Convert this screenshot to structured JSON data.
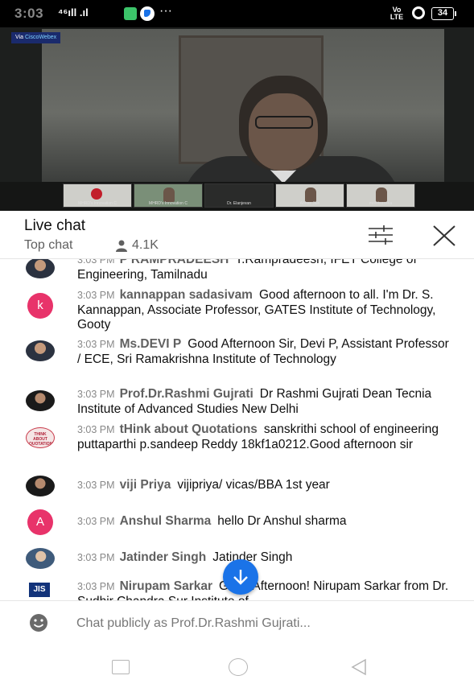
{
  "status_bar": {
    "time": "3:03",
    "signal": "⁴⁶ıll .ıl",
    "dots": "···",
    "volte": "Vo LTE",
    "battery": "34"
  },
  "video": {
    "badge_prefix": "Via ",
    "badge_brand": "CiscoWebex",
    "thumbnails": [
      "MHRD's Innovation C",
      "MHRD's Innovation C",
      "Dr. Elanjevan",
      "Abhas Jain",
      "mohitsaxena"
    ]
  },
  "chat": {
    "title": "Live chat",
    "mode": "Top chat",
    "viewers": "4.1K",
    "messages": [
      {
        "time": "3:03 PM",
        "author": "P RAMPRADEESH",
        "text": "T.Rampradeesh, IFET College of Engineering, Tamilnadu",
        "avatar": "photo"
      },
      {
        "time": "3:03 PM",
        "author": "kannappan sadasivam",
        "text": "Good afternoon to all. I'm Dr. S. Kannappan, Associate Professor, GATES Institute of Technology, Gooty",
        "avatar": "k"
      },
      {
        "time": "3:03 PM",
        "author": "Ms.DEVI P",
        "text": "Good Afternoon Sir, Devi P, Assistant Professor / ECE, Sri Ramakrishna Institute of Technology",
        "avatar": "photo"
      },
      {
        "time": "3:03 PM",
        "author": "Prof.Dr.Rashmi Gujrati",
        "text": "Dr Rashmi Gujrati Dean Tecnia Institute of Advanced Studies New Delhi",
        "avatar": "photo2"
      },
      {
        "time": "3:03 PM",
        "author": "tHink about Quotations",
        "text": "sanskrithi school of engineering puttaparthi p.sandeep Reddy 18kf1a0212.Good afternoon sir",
        "avatar": "quote",
        "avatar_text": "THINK ABOUT QUOTATIONS"
      },
      {
        "time": "3:03 PM",
        "author": "viji Priya",
        "text": "vijipriya/ vicas/BBA 1st year",
        "avatar": "photo2"
      },
      {
        "time": "3:03 PM",
        "author": "Anshul Sharma",
        "text": "hello Dr Anshul sharma",
        "avatar": "A"
      },
      {
        "time": "3:03 PM",
        "author": "Jatinder Singh",
        "text": "Jatinder Singh",
        "avatar": "photo3"
      },
      {
        "time": "3:03 PM",
        "author": "Nirupam Sarkar",
        "text": "Good Afternoon! Nirupam Sarkar from Dr. Sudhir Chandra Sur Institute of",
        "avatar": "jis",
        "avatar_text": "JIS"
      }
    ]
  },
  "input": {
    "placeholder": "Chat publicly as Prof.Dr.Rashmi Gujrati..."
  },
  "colors": {
    "accent": "#1a73e8",
    "letter_avatar": "#e8336a"
  },
  "icons": [
    "filter-icon",
    "close-icon",
    "person-icon",
    "emoji-icon",
    "arrow-down-icon",
    "recent-apps-icon",
    "home-icon",
    "back-icon"
  ]
}
